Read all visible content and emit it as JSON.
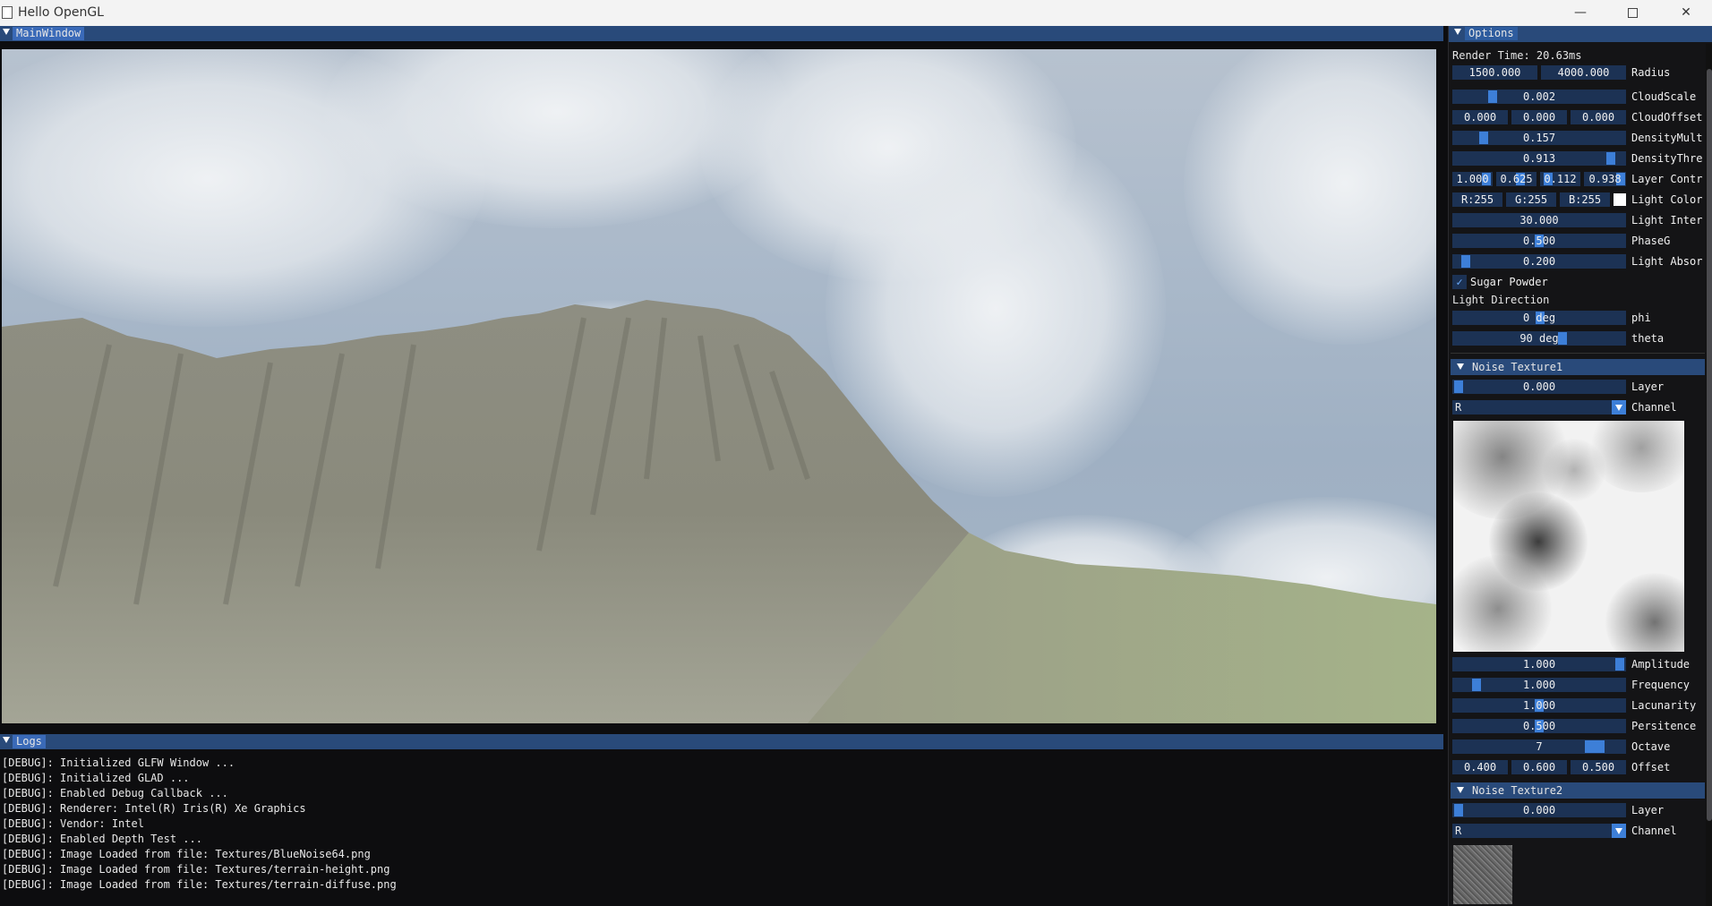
{
  "window": {
    "title": "Hello OpenGL",
    "minimize": "—",
    "close": "✕"
  },
  "main_window": {
    "tab_label": "MainWindow"
  },
  "logs": {
    "tab_label": "Logs",
    "lines": [
      "[DEBUG]: Initialized GLFW Window ...",
      "[DEBUG]: Initialized GLAD ...",
      "[DEBUG]: Enabled Debug Callback ...",
      "[DEBUG]: Renderer: Intel(R) Iris(R) Xe Graphics",
      "[DEBUG]: Vendor: Intel",
      "[DEBUG]: Enabled Depth Test ...",
      "[DEBUG]: Image Loaded from file: Textures/BlueNoise64.png",
      "[DEBUG]: Image Loaded from file: Textures/terrain-height.png",
      "[DEBUG]: Image Loaded from file: Textures/terrain-diffuse.png"
    ]
  },
  "options": {
    "tab_label": "Options",
    "render_time": "Render Time: 20.63ms",
    "radius": {
      "label": "Radius",
      "min": "1500.000",
      "max": "4000.000"
    },
    "cloud_scale": {
      "label": "CloudScale",
      "value": "0.002",
      "level": 0.22
    },
    "cloud_offset": {
      "label": "CloudOffset",
      "x": "0.000",
      "y": "0.000",
      "z": "0.000"
    },
    "density_mult": {
      "label": "DensityMult",
      "value": "0.157",
      "level": 0.16
    },
    "density_thresh": {
      "label": "DensityThre",
      "value": "0.913",
      "level": 0.91
    },
    "layer_contrib": {
      "label": "Layer Contr",
      "values": [
        "1.000",
        "0.625",
        "0.112",
        "0.938"
      ]
    },
    "light_color": {
      "label": "Light Color",
      "r": "R:255",
      "g": "G:255",
      "b": "B:255",
      "swatch": "#ffffff"
    },
    "light_intensity": {
      "label": "Light Inter",
      "value": "30.000"
    },
    "phase_g": {
      "label": "PhaseG",
      "value": "0.500",
      "level": 0.5
    },
    "light_absorb": {
      "label": "Light Absor",
      "value": "0.200",
      "level": 0.05
    },
    "sugar_powder": {
      "label": "Sugar Powder",
      "checked": true,
      "check_mark": "✓"
    },
    "light_direction": {
      "label": "Light Direction",
      "phi": {
        "label": "phi",
        "value": "0 deg",
        "level": 0.5
      },
      "theta": {
        "label": "theta",
        "value": "90 deg",
        "level": 0.62
      }
    },
    "noise1": {
      "title": "Noise Texture1",
      "layer": {
        "label": "Layer",
        "value": "0.000"
      },
      "channel": {
        "label": "Channel",
        "value": "R"
      },
      "amplitude": {
        "label": "Amplitude",
        "value": "1.000",
        "level": 0.97
      },
      "frequency": {
        "label": "Frequency",
        "value": "1.000",
        "level": 0.12
      },
      "lacunarity": {
        "label": "Lacunarity",
        "value": "1.000",
        "level": 0.5
      },
      "persistence": {
        "label": "Persitence",
        "value": "0.500",
        "level": 0.5
      },
      "octave": {
        "label": "Octave",
        "value": "7",
        "level": 0.8
      },
      "offset": {
        "label": "Offset",
        "x": "0.400",
        "y": "0.600",
        "z": "0.500"
      }
    },
    "noise2": {
      "title": "Noise Texture2",
      "layer": {
        "label": "Layer",
        "value": "0.000"
      },
      "channel": {
        "label": "Channel",
        "value": "R"
      }
    }
  }
}
